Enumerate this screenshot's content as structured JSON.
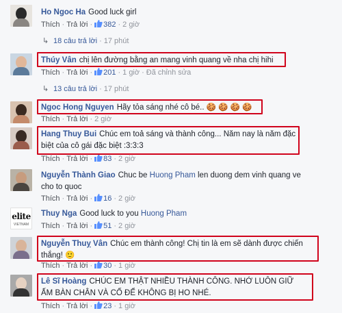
{
  "ui": {
    "action_like": "Thích",
    "action_reply": "Trả lời",
    "dot": "·",
    "edited": "Đã chỉnh sửa"
  },
  "comments": [
    {
      "name": "Ho Ngoc Ha",
      "text": "Good luck girl",
      "likes": "382",
      "time": "2 giờ",
      "replies": {
        "label": "18 câu trả lời",
        "time": "17 phút"
      }
    },
    {
      "name": "Thúy Vân",
      "text": "chị lên đường bằng an mang vinh quang về nha chị hihi",
      "likes": "201",
      "time": "1 giờ",
      "edited": true,
      "replies": {
        "label": "13 câu trả lời",
        "time": "17 phút"
      }
    },
    {
      "name": "Ngoc Hong Nguyen",
      "text": "Hãy tỏa sáng nhé cô bé..",
      "emoji": "🍪 🍪 🍪 🍪",
      "likes": "",
      "time": "2 giờ"
    },
    {
      "name": "Hang Thuy Bui",
      "text": "Chúc em toả sáng và thành công... Năm nay là năm đặc biệt của cô gái đặc biệt :3:3:3",
      "likes": "83",
      "time": "2 giờ"
    },
    {
      "name": "Nguyễn Thành Giao",
      "text_before": "Chuc be",
      "tag": "Huong Pham",
      "text_after": "len duong dem vinh quang ve cho to quoc",
      "likes": "16",
      "time": "2 giờ"
    },
    {
      "name": "Thuy Nga",
      "text_before": "Good luck to you",
      "tag": "Huong Pham",
      "likes": "51",
      "time": "2 giờ"
    },
    {
      "name": "Nguyễn Thuỵ Vân",
      "text": "Chúc em thành công! Chị tin là em sẽ dành được chiến thắng!",
      "emoji": "🙂",
      "likes": "30",
      "time": "1 giờ"
    },
    {
      "name": "Lê Sĩ Hoàng",
      "text": "CHÚC EM THẬT NHIỀU THÀNH CÔNG. NHỚ LUÔN GIỮ ẤM BÀN CHÂN VÀ CỐ ĐỂ KHÔNG BỊ HO NHÉ.",
      "likes": "23",
      "time": "1 giờ"
    }
  ],
  "avatar_logo_text": "elite",
  "avatar_logo_sub": "VIETNAM",
  "colors": {
    "link": "#365899",
    "meta": "#90949c",
    "highlight": "#d0021b",
    "background": "#f6f7f9"
  }
}
